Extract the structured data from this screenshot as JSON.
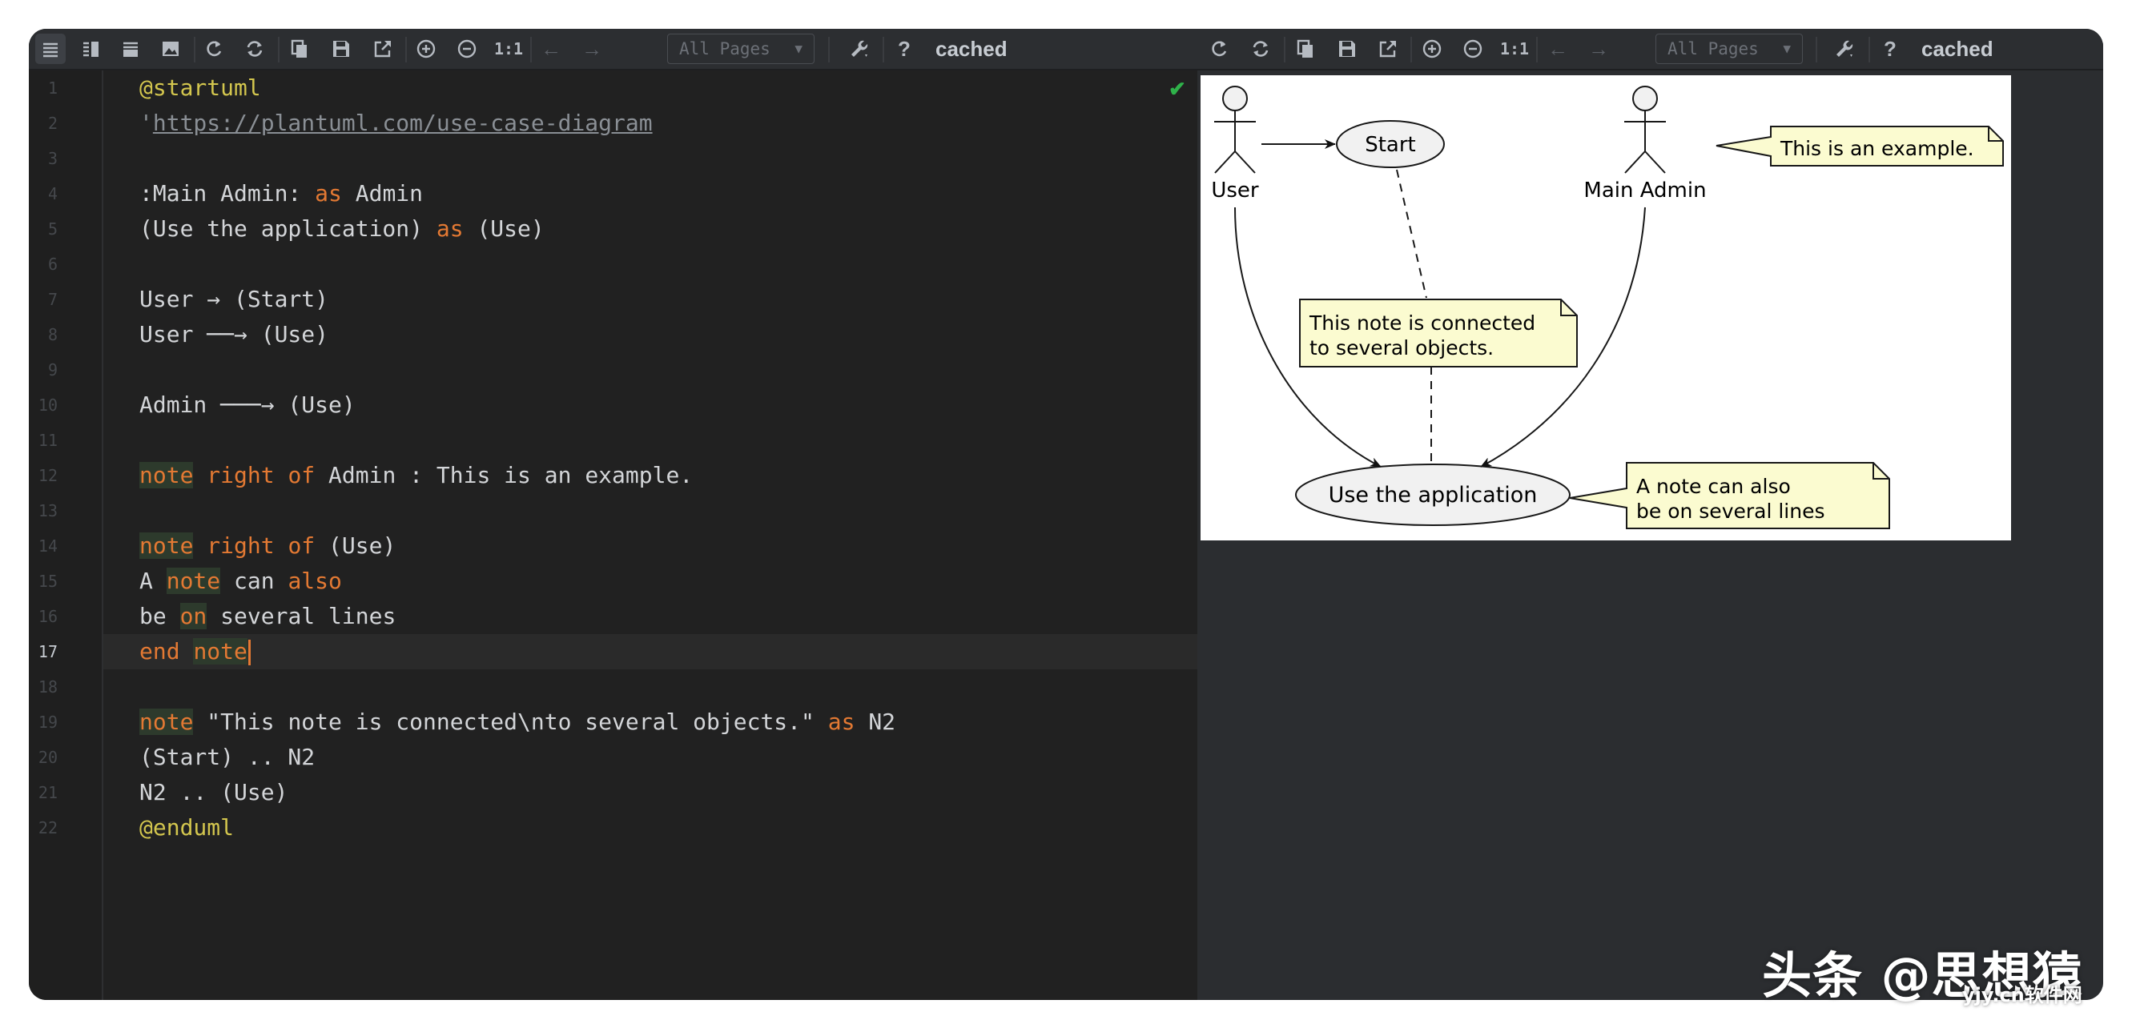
{
  "toolbar": {
    "pages_select": "All Pages",
    "help_label": "?",
    "status": "cached",
    "zoom_reset_label": "1:1"
  },
  "editor": {
    "line_numbers": [
      "1",
      "2",
      "3",
      "4",
      "5",
      "6",
      "7",
      "8",
      "9",
      "10",
      "11",
      "12",
      "13",
      "14",
      "15",
      "16",
      "17",
      "18",
      "19",
      "20",
      "21",
      "22"
    ],
    "current_line": 17,
    "lines": {
      "l1": "@startuml",
      "l2_prefix": "'",
      "l2_url": "https://plantuml.com/use-case-diagram",
      "l4a": ":Main Admin: ",
      "l4b": "as",
      "l4c": " Admin",
      "l5a": "(Use the application) ",
      "l5b": "as",
      "l5c": " (Use)",
      "l7": "User → (Start)",
      "l8": "User ──→ (Use)",
      "l10": "Admin ───→ (Use)",
      "l12a": "note",
      "l12b": "right",
      "l12c": "of",
      "l12d": " Admin : This is an example.",
      "l14a": "note",
      "l14b": "right",
      "l14c": "of",
      "l14d": " (Use)",
      "l15a": "A ",
      "l15b": "note",
      "l15c": " can ",
      "l15d": "also",
      "l16a": "be ",
      "l16b": "on",
      "l16c": " several lines",
      "l17a": "end",
      "l17b": "note",
      "l19a": "note",
      "l19b": " \"This note is connected\\nto several objects.\" ",
      "l19c": "as",
      "l19d": " N2",
      "l20": "(Start) .. N2",
      "l21": "N2 .. (Use)",
      "l22": "@enduml"
    }
  },
  "diagram": {
    "actor_user": "User",
    "actor_admin": "Main Admin",
    "usecase_start": "Start",
    "usecase_use": "Use the application",
    "note_admin": "This is an example.",
    "note_n2_line1": "This note is connected",
    "note_n2_line2": "to several objects.",
    "note_use_line1": "A note can also",
    "note_use_line2": "be on several lines"
  },
  "watermark": {
    "main": "头条 @思想猿",
    "small": "yjy.cn软件网"
  },
  "colors": {
    "editor_bg": "#212121",
    "keyword": "#e37933",
    "annotation": "#d3c64e",
    "ok_check": "#2fb24a",
    "note_fill": "#fbfbd0",
    "usecase_fill": "#f1f1f1"
  }
}
